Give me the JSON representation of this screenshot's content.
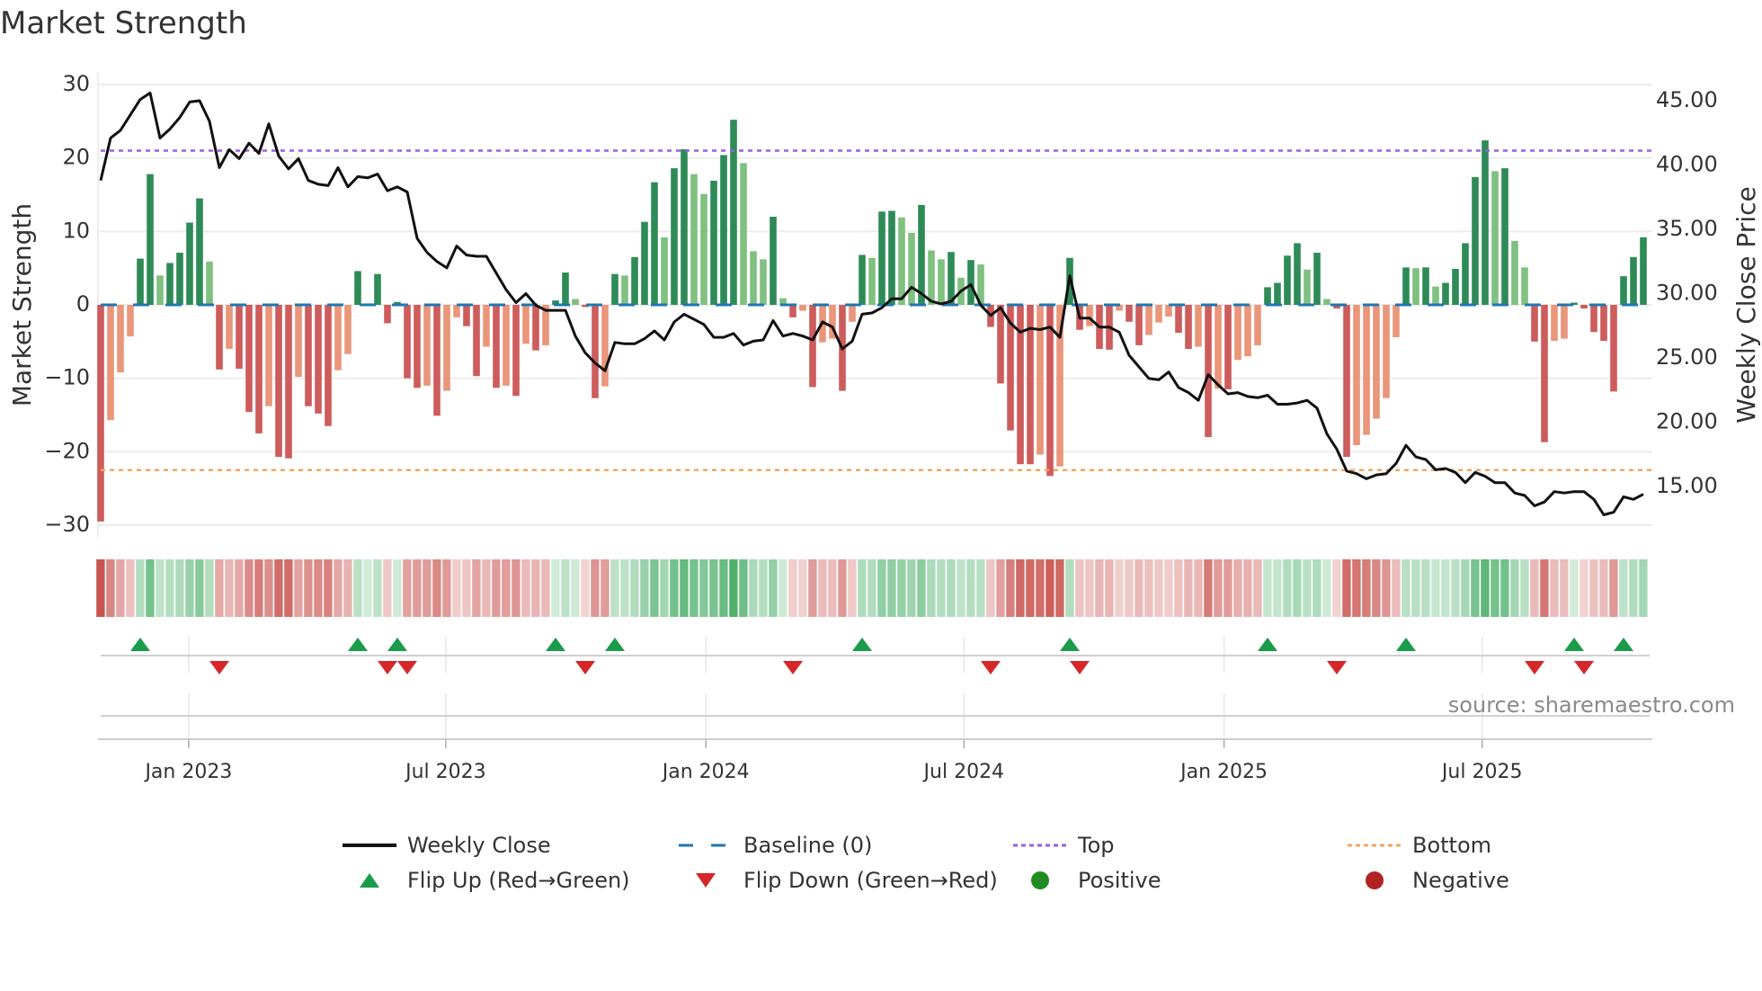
{
  "title": "Market Strength",
  "source": "source: sharemaestro.com",
  "colors": {
    "pos_dark": "#2e8b57",
    "pos_light": "#80c080",
    "neg_dark": "#cd5c5c",
    "neg_light": "#e9967a",
    "close": "#111111",
    "baseline": "#1f77b4",
    "top": "#9b5fe0",
    "bottom": "#f4a460",
    "flip_up": "#1a9c4a",
    "flip_down": "#d62728",
    "positive": "#228b22",
    "negative": "#b22222"
  },
  "legend": {
    "weekly_close": "Weekly Close",
    "baseline": "Baseline (0)",
    "top": "Top",
    "bottom": "Bottom",
    "flip_up": "Flip Up (Red→Green)",
    "flip_down": "Flip Down (Green→Red)",
    "positive": "Positive",
    "negative": "Negative"
  },
  "chart_data": {
    "type": "bar+line",
    "title": "Market Strength",
    "ylabel": "Market Strength",
    "y2label": "Weekly Close Price",
    "ylim": [
      -31.6,
      31.6
    ],
    "y2lim": [
      11.1,
      47.2
    ],
    "yticks": [
      30,
      20,
      10,
      0,
      -10,
      -20,
      -30
    ],
    "ytick_labels": [
      "30",
      "20",
      "10",
      "0",
      "−10",
      "−20",
      "−30"
    ],
    "y2ticks": [
      45,
      40,
      35,
      30,
      25,
      20,
      15
    ],
    "y2tick_labels": [
      "45.00",
      "40.00",
      "35.00",
      "30.00",
      "25.00",
      "20.00",
      "15.00"
    ],
    "xticks": [
      {
        "label": "Jan 2023",
        "week_index": 8.9
      },
      {
        "label": "Jul 2023",
        "week_index": 34.9
      },
      {
        "label": "Jan 2024",
        "week_index": 61.2
      },
      {
        "label": "Jul 2024",
        "week_index": 87.3
      },
      {
        "label": "Jan 2025",
        "week_index": 113.6
      },
      {
        "label": "Jul 2025",
        "week_index": 139.7
      }
    ],
    "thresholds": {
      "top": 21,
      "bottom": -22.5,
      "baseline": 0
    },
    "series": [
      {
        "name": "Market Strength",
        "type": "bar",
        "values": [
          -29.5,
          -15.7,
          -9.2,
          -4.3,
          6.3,
          17.8,
          4.0,
          5.7,
          7.1,
          11.2,
          14.5,
          5.9,
          -8.8,
          -6.0,
          -8.7,
          -14.6,
          -17.5,
          -13.8,
          -20.7,
          -20.9,
          -9.8,
          -13.8,
          -14.8,
          -16.5,
          -8.9,
          -6.7,
          4.6,
          0.2,
          4.2,
          -2.5,
          0.4,
          -10.0,
          -11.3,
          -11.0,
          -15.1,
          -11.7,
          -1.7,
          -2.9,
          -9.7,
          -5.7,
          -11.3,
          -11.0,
          -12.4,
          -5.3,
          -6.2,
          -5.5,
          0.6,
          4.4,
          0.8,
          -0.3,
          -12.7,
          -11.1,
          4.2,
          4.0,
          6.5,
          11.3,
          16.7,
          9.2,
          18.6,
          21.2,
          17.8,
          15.1,
          16.9,
          20.4,
          25.2,
          19.3,
          7.3,
          6.2,
          12.0,
          0.9,
          -1.7,
          -0.8,
          -11.2,
          -5.1,
          -4.6,
          -11.7,
          -2.3,
          6.8,
          6.4,
          12.7,
          12.8,
          11.9,
          9.8,
          13.6,
          7.4,
          6.2,
          7.2,
          3.7,
          6.1,
          5.5,
          -3.0,
          -10.7,
          -17.1,
          -21.7,
          -21.7,
          -20.4,
          -23.3,
          -22.0,
          6.4,
          -3.4,
          -2.9,
          -6.0,
          -6.1,
          -0.8,
          -2.3,
          -5.5,
          -4.1,
          -2.4,
          -1.6,
          -3.8,
          -6.0,
          -5.7,
          -18.0,
          -11.4,
          -11.5,
          -7.5,
          -7.0,
          -5.5,
          2.4,
          3.0,
          6.7,
          8.4,
          4.8,
          7.1,
          0.8,
          -0.5,
          -20.7,
          -19.1,
          -17.7,
          -15.5,
          -12.7,
          -4.4,
          5.1,
          5.0,
          5.1,
          2.5,
          3.0,
          4.9,
          8.4,
          17.4,
          22.4,
          18.2,
          18.6,
          8.7,
          5.1,
          -5.0,
          -18.7,
          -4.9,
          -4.6,
          0.3,
          -0.5,
          -3.7,
          -4.9,
          -11.8,
          3.9,
          6.5,
          9.2
        ]
      },
      {
        "name": "Weekly Close",
        "type": "line",
        "axis": "right",
        "values": [
          38.8,
          42.1,
          42.7,
          43.9,
          45.1,
          45.6,
          42.1,
          42.8,
          43.7,
          44.9,
          45.0,
          43.4,
          39.8,
          41.2,
          40.5,
          41.7,
          40.9,
          43.2,
          40.7,
          39.7,
          40.5,
          38.8,
          38.5,
          38.4,
          39.8,
          38.3,
          39.1,
          39.0,
          39.3,
          38.0,
          38.3,
          37.9,
          34.3,
          33.2,
          32.5,
          32.0,
          33.7,
          33.0,
          32.9,
          32.9,
          31.6,
          30.3,
          29.3,
          30.0,
          29.1,
          28.7,
          28.7,
          28.7,
          26.7,
          25.4,
          24.6,
          24.0,
          26.2,
          26.1,
          26.1,
          26.5,
          27.1,
          26.4,
          27.8,
          28.4,
          28.0,
          27.6,
          26.6,
          26.6,
          26.9,
          26.0,
          26.3,
          26.4,
          27.9,
          26.7,
          26.9,
          26.7,
          26.4,
          27.8,
          27.4,
          25.7,
          26.3,
          28.4,
          28.5,
          28.9,
          29.6,
          29.6,
          30.5,
          30.0,
          29.4,
          29.2,
          29.4,
          30.2,
          30.7,
          29.1,
          28.3,
          28.9,
          27.7,
          27.0,
          27.3,
          27.2,
          27.4,
          26.6,
          31.4,
          28.1,
          28.1,
          27.4,
          27.4,
          27.0,
          25.2,
          24.3,
          23.4,
          23.3,
          23.9,
          22.7,
          22.3,
          21.7,
          23.7,
          22.9,
          22.2,
          22.3,
          22.0,
          21.9,
          22.1,
          21.4,
          21.4,
          21.5,
          21.7,
          21.1,
          19.1,
          17.9,
          16.2,
          16.0,
          15.6,
          15.9,
          16.0,
          16.8,
          18.2,
          17.3,
          17.1,
          16.3,
          16.4,
          16.1,
          15.3,
          16.1,
          15.8,
          15.3,
          15.3,
          14.5,
          14.3,
          13.5,
          13.8,
          14.6,
          14.5,
          14.6,
          14.6,
          14.0,
          12.8,
          13.0,
          14.2,
          14.0,
          14.4
        ]
      }
    ],
    "legend_position": "bottom"
  }
}
